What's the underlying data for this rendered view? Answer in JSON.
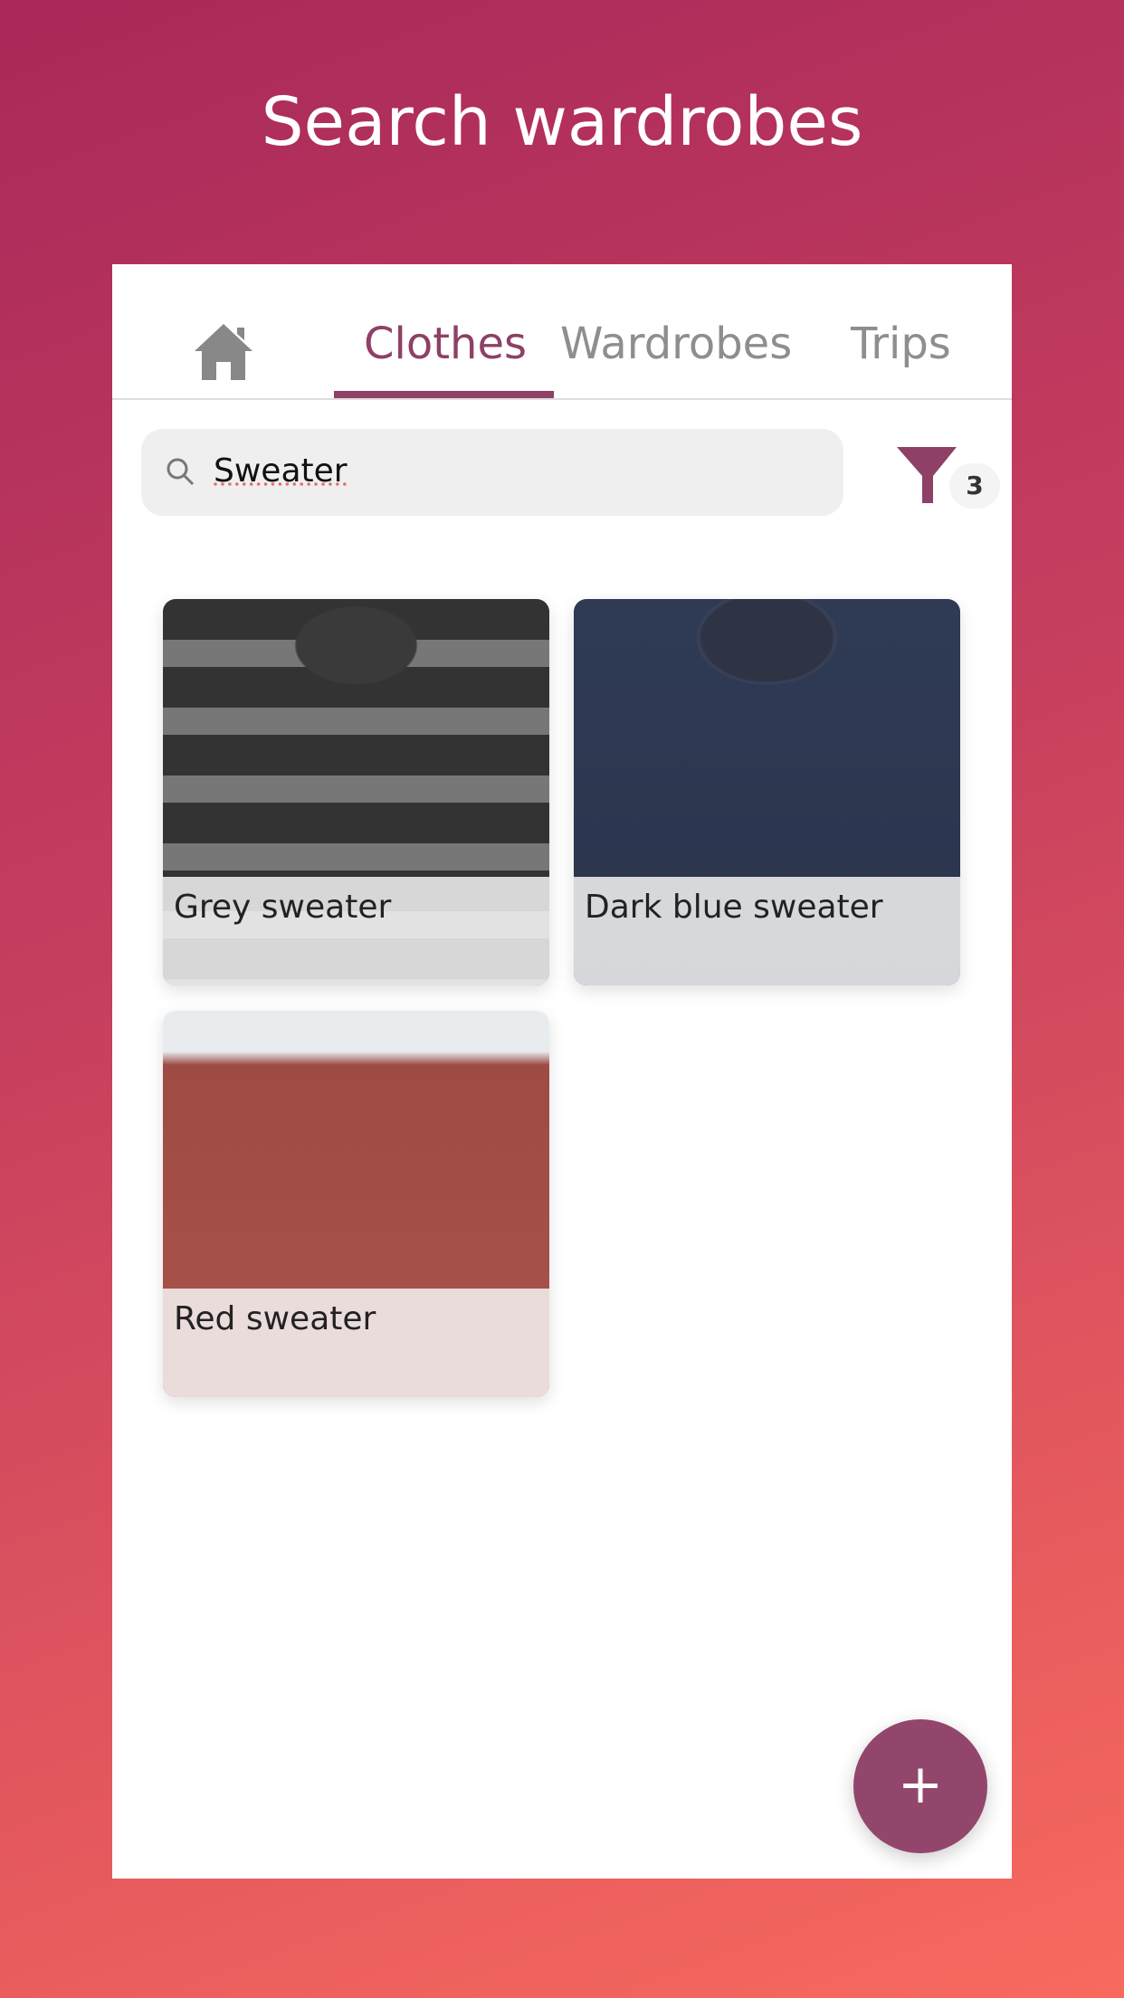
{
  "header": {
    "title": "Search wardrobes"
  },
  "tabs": [
    {
      "label": "Clothes",
      "active": true
    },
    {
      "label": "Wardrobes"
    },
    {
      "label": "Trips"
    }
  ],
  "search": {
    "value": "Sweater"
  },
  "filter": {
    "count": "3"
  },
  "items": [
    {
      "label": "Grey sweater"
    },
    {
      "label": "Dark blue sweater"
    },
    {
      "label": "Red sweater"
    }
  ],
  "colors": {
    "accent": "#8e4066",
    "fab": "#93466b"
  },
  "fab": {
    "icon": "plus-icon",
    "label": "+"
  }
}
